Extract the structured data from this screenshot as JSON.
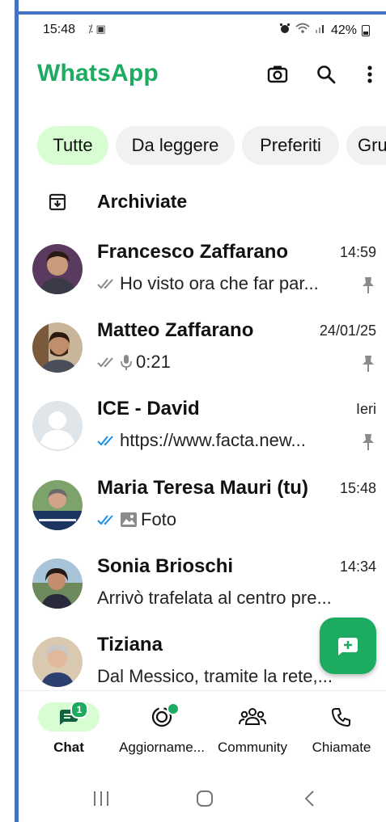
{
  "status_bar": {
    "time": "15:48",
    "extra_icons": "⁒ ▣",
    "battery": "42%"
  },
  "header": {
    "title": "WhatsApp",
    "icons": [
      "camera-icon",
      "search-icon",
      "more-vert-icon"
    ]
  },
  "filters": [
    {
      "label": "Tutte",
      "active": true
    },
    {
      "label": "Da leggere",
      "active": false
    },
    {
      "label": "Preferiti",
      "active": false
    },
    {
      "label": "Gru",
      "active": false
    }
  ],
  "archived": {
    "label": "Archiviate"
  },
  "chats": [
    {
      "name": "Francesco Zaffarano",
      "time": "14:59",
      "preview": "Ho visto ora che far par...",
      "ticks": "read-gray",
      "pinned": true
    },
    {
      "name": "Matteo Zaffarano",
      "time": "24/01/25",
      "preview": "0:21",
      "ticks": "read-gray",
      "voice": true,
      "pinned": true
    },
    {
      "name": "ICE - David",
      "time": "Ieri",
      "preview": "https://www.facta.new...",
      "ticks": "read-blue",
      "pinned": true
    },
    {
      "name": "Maria Teresa Mauri (tu)",
      "time": "15:48",
      "preview": "Foto",
      "ticks": "read-blue",
      "photo": true
    },
    {
      "name": "Sonia Brioschi",
      "time": "14:34",
      "preview": "Arrivò trafelata al centro pre..."
    },
    {
      "name": "Tiziana",
      "time": "",
      "preview": "Dal Messico, tramite la rete,..."
    }
  ],
  "bottom_nav": [
    {
      "label": "Chat",
      "badge": "1",
      "active": true
    },
    {
      "label": "Aggiorname...",
      "dot": true
    },
    {
      "label": "Community"
    },
    {
      "label": "Chiamate"
    }
  ],
  "colors": {
    "accent": "#1daa61",
    "chip_active": "#d8fdd2",
    "blue_tick": "#1b8fe6"
  }
}
